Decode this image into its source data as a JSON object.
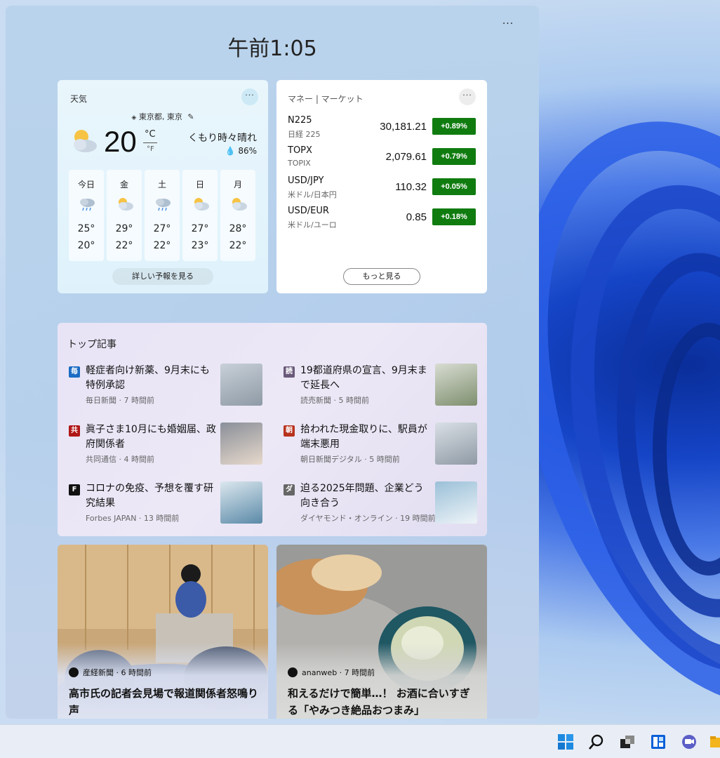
{
  "panel": {
    "menu_label": "···",
    "clock": "午前1:05"
  },
  "weather": {
    "title": "天気",
    "more_label": "···",
    "location": "東京都, 東京",
    "temperature": "20",
    "unit_c": "°C",
    "unit_f": "°F",
    "condition": "くもり時々晴れ",
    "humidity": "86%",
    "forecast": [
      {
        "day": "今日",
        "icon": "rain-cloud-icon",
        "high": "25°",
        "low": "20°"
      },
      {
        "day": "金",
        "icon": "partly-sunny-icon",
        "high": "29°",
        "low": "22°"
      },
      {
        "day": "土",
        "icon": "rain-cloud-icon",
        "high": "27°",
        "low": "22°"
      },
      {
        "day": "日",
        "icon": "partly-sunny-icon",
        "high": "27°",
        "low": "23°"
      },
      {
        "day": "月",
        "icon": "partly-sunny-icon",
        "high": "28°",
        "low": "22°"
      }
    ],
    "detail_label": "詳しい予報を見る"
  },
  "market": {
    "title": "マネー | マーケット",
    "more_label": "···",
    "rows": [
      {
        "symbol": "N225",
        "name": "日経 225",
        "value": "30,181.21",
        "change": "+0.89%"
      },
      {
        "symbol": "TOPX",
        "name": "TOPIX",
        "value": "2,079.61",
        "change": "+0.79%"
      },
      {
        "symbol": "USD/JPY",
        "name": "米ドル/日本円",
        "value": "110.32",
        "change": "+0.05%"
      },
      {
        "symbol": "USD/EUR",
        "name": "米ドル/ユーロ",
        "value": "0.85",
        "change": "+0.18%"
      }
    ],
    "positive_color": "#107c10",
    "more_button": "もっと見る"
  },
  "stories": {
    "title": "トップ記事",
    "items": [
      {
        "logo": "毎",
        "headline": "軽症者向け新薬、9月末にも特例承認",
        "source": "毎日新聞 · 7 時間前"
      },
      {
        "logo": "読",
        "headline": "19都道府県の宣言、9月末まで延長へ",
        "source": "読売新聞 · 5 時間前"
      },
      {
        "logo": "共",
        "headline": "眞子さま10月にも婚姻届、政府関係者",
        "source": "共同通信 · 4 時間前"
      },
      {
        "logo": "朝",
        "headline": "拾われた現金取りに、駅員が端末悪用",
        "source": "朝日新聞デジタル · 5 時間前"
      },
      {
        "logo": "F",
        "headline": "コロナの免疫、予想を覆す研究結果",
        "source": "Forbes JAPAN · 13 時間前"
      },
      {
        "logo": "ダ",
        "headline": "迫る2025年問題、企業どう向き合う",
        "source": "ダイヤモンド・オンライン · 19 時間前"
      }
    ]
  },
  "features": [
    {
      "source": "産経新聞 · 6 時間前",
      "title": "高市氏の記者会見場で報道関係者怒鳴り声"
    },
    {
      "source": "ananweb · 7 時間前",
      "title": "和えるだけで簡単…！ お酒に合いすぎる「やみつき絶品おつまみ」"
    }
  ],
  "taskbar": {
    "icons": [
      "start-icon",
      "search-icon",
      "task-view-icon",
      "widgets-icon",
      "chat-icon",
      "file-explorer-icon"
    ],
    "accent": "#0a5fd8"
  }
}
